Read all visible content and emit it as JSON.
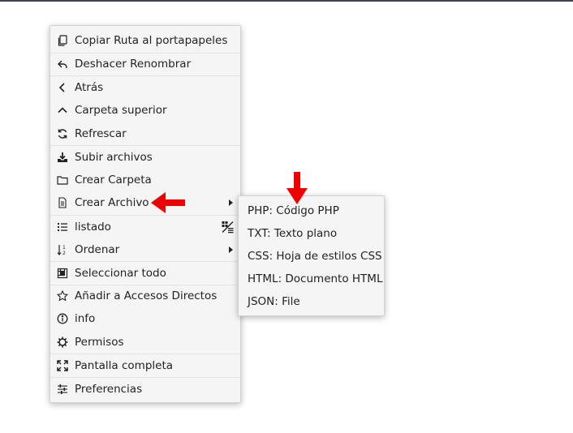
{
  "context_menu": {
    "items": [
      {
        "label": "Copiar Ruta al portapapeles",
        "icon": "copy-icon"
      },
      {
        "label": "Deshacer Renombrar",
        "icon": "undo-icon"
      },
      {
        "label": "Atrás",
        "icon": "chevron-left-icon"
      },
      {
        "label": "Carpeta superior",
        "icon": "chevron-up-icon"
      },
      {
        "label": "Refrescar",
        "icon": "refresh-icon"
      },
      {
        "label": "Subir archivos",
        "icon": "upload-icon"
      },
      {
        "label": "Crear Carpeta",
        "icon": "folder-icon"
      },
      {
        "label": "Crear Archivo",
        "icon": "file-icon",
        "has_submenu": true
      },
      {
        "label": "listado",
        "icon": "list-icon"
      },
      {
        "label": "Ordenar",
        "icon": "sort-icon",
        "has_submenu": true
      },
      {
        "label": "Seleccionar todo",
        "icon": "select-all-icon"
      },
      {
        "label": "Añadir a Accesos Directos",
        "icon": "star-icon"
      },
      {
        "label": "info",
        "icon": "info-icon"
      },
      {
        "label": "Permisos",
        "icon": "gear-icon"
      },
      {
        "label": "Pantalla completa",
        "icon": "fullscreen-icon"
      },
      {
        "label": "Preferencias",
        "icon": "sliders-icon"
      }
    ]
  },
  "create_file_submenu": {
    "items": [
      {
        "label": "PHP: Código PHP"
      },
      {
        "label": "TXT: Texto plano"
      },
      {
        "label": "CSS: Hoja de estilos CSS"
      },
      {
        "label": "HTML: Documento HTML"
      },
      {
        "label": "JSON: File"
      }
    ]
  },
  "colors": {
    "menu_background": "#f5f5f5",
    "annotation_arrow": "#ee0000",
    "top_bar": "#3d4350"
  }
}
